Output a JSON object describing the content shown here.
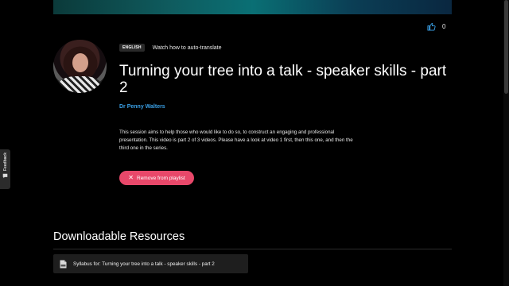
{
  "hero": {
    "colors": [
      "#0b3a3a",
      "#0a6f74",
      "#0a2740"
    ]
  },
  "likes": {
    "count": "0",
    "icon": "thumbs-up-icon"
  },
  "meta": {
    "language": "ENGLISH",
    "auto_translate": "Watch how to auto-translate"
  },
  "video": {
    "title": "Turning your tree into a talk - speaker skills - part 2",
    "author": "Dr Penny Walters",
    "description": "This session aims to help those who would like to do so, to construct an engaging and professional presentation. This video is part 2 of 3 videos. Please have a look at video 1 first, then this one, and then the third one in the series."
  },
  "actions": {
    "remove_label": "Remove from playlist",
    "remove_icon": "close-icon",
    "accent": "#e8486a"
  },
  "resources": {
    "heading": "Downloadable Resources",
    "items": [
      {
        "label": "Syllabus for: Turning your tree into a talk - speaker skills - part 2",
        "icon": "pdf-document-icon"
      }
    ]
  },
  "feedback": {
    "label": "Feedback",
    "icon": "feedback-icon"
  },
  "theme": {
    "background": "#000000",
    "link": "#3aa0e6"
  }
}
